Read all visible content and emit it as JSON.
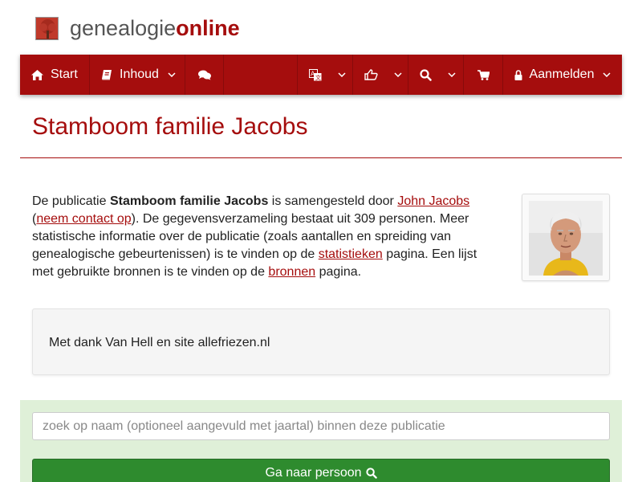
{
  "brand": {
    "part1": "genealogie",
    "part2": "online"
  },
  "nav": {
    "start": "Start",
    "inhoud": "Inhoud",
    "aanmelden": "Aanmelden"
  },
  "page": {
    "title": "Stamboom familie Jacobs"
  },
  "intro": {
    "t1": "De publicatie ",
    "pub_name": "Stamboom familie Jacobs",
    "t2": " is samengesteld door ",
    "author_link": "John Jacobs",
    "t3": "(",
    "contact_link": "neem contact op",
    "t4": "). De gegevensverzameling bestaat uit 309 personen. Meer statistische informatie over de publicatie (zoals aantallen en spreiding van genealogische gebeurtenissen) is te vinden op de ",
    "stats_link": "statistieken",
    "t5": " pagina. Een lijst met gebruikte bronnen is te vinden op de ",
    "sources_link": "bronnen",
    "t6": " pagina."
  },
  "thanks": "Met dank Van Hell en site allefriezen.nl",
  "search": {
    "placeholder": "zoek op naam (optioneel aangevuld met jaartal) binnen deze publicatie",
    "button": "Ga naar persoon"
  },
  "colors": {
    "brand_red": "#a50d0d",
    "search_bg": "#dff0d8",
    "button_green": "#2e8b2e"
  },
  "icons": [
    "home-icon",
    "book-icon",
    "comments-icon",
    "translate-icon",
    "thumbs-up-icon",
    "search-icon",
    "cart-icon",
    "lock-icon",
    "chevron-down-icon"
  ]
}
